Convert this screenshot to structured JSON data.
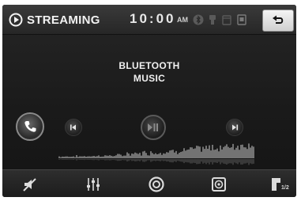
{
  "header": {
    "source_title": "STREAMING",
    "clock_time": "10:00",
    "clock_ampm": "AM"
  },
  "main": {
    "line1": "BLUETOOTH",
    "line2": "MUSIC"
  },
  "bottom": {
    "page_indicator": "1/2"
  },
  "icons": {
    "source": "play-circle-icon",
    "status": [
      "bluetooth-icon",
      "usb-icon",
      "sd-card-icon",
      "device-icon"
    ],
    "back": "back-arrow-icon",
    "phone": "phone-icon",
    "prev": "previous-track-icon",
    "play_pause": "play-pause-icon",
    "next": "next-track-icon",
    "bottom": [
      "mute-icon",
      "equalizer-icon",
      "disc-icon",
      "speaker-icon",
      "page-icon"
    ]
  },
  "colors": {
    "background": "#1a1a1a",
    "text": "#f0f0f0",
    "back_button": "#e6e6e6"
  }
}
